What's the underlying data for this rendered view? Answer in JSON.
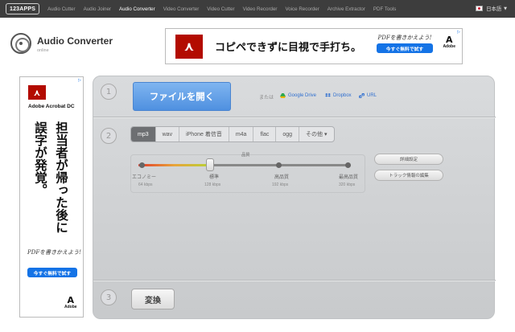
{
  "topbar": {
    "brand": "123APPS",
    "nav": [
      "Audio Cutter",
      "Audio Joiner",
      "Audio Converter",
      "Video Converter",
      "Video Cutter",
      "Video Recorder",
      "Voice Recorder",
      "Archive Extractor",
      "PDF Tools"
    ],
    "active_index": 2,
    "language": "日本語"
  },
  "app": {
    "title": "Audio Converter",
    "subtitle": "online"
  },
  "ad_top": {
    "logo_glyph": "⋏",
    "headline": "コピペできずに目視で手打ち。",
    "script": "PDFを書きかえよう!",
    "cta": "今すぐ無料で試す",
    "brand": "Adobe"
  },
  "ad_side": {
    "logo_glyph": "⋏",
    "name": "Adobe Acrobat DC",
    "line1": "担当者が帰った後に",
    "line2": "誤字が発覚。",
    "script": "PDFを書きかえよう!",
    "cta": "今すぐ無料で試す",
    "brand": "Adobe"
  },
  "steps": {
    "s1": "1",
    "s2": "2",
    "s3": "3"
  },
  "open": {
    "button": "ファイルを開く",
    "or": "または",
    "sources": [
      "Google Drive",
      "Dropbox",
      "URL"
    ]
  },
  "formats": {
    "items": [
      "mp3",
      "wav",
      "iPhone 着信音",
      "m4a",
      "flac",
      "ogg",
      "その他"
    ],
    "selected": 0,
    "more_caret": "▾"
  },
  "quality": {
    "label": "品質",
    "levels": [
      {
        "name": "エコノミー",
        "rate": "64 kbps"
      },
      {
        "name": "標準",
        "rate": "128 kbps"
      },
      {
        "name": "高品質",
        "rate": "192 kbps"
      },
      {
        "name": "最高品質",
        "rate": "320 kbps"
      }
    ],
    "selected_index": 1
  },
  "buttons": {
    "advanced": "詳細設定",
    "track_info": "トラック情報の編集",
    "convert": "変換"
  },
  "colors": {
    "open_button": "#5a9ae5",
    "link": "#2f6fd0",
    "adobe_red": "#b30b00",
    "cta_blue": "#1473e6"
  }
}
